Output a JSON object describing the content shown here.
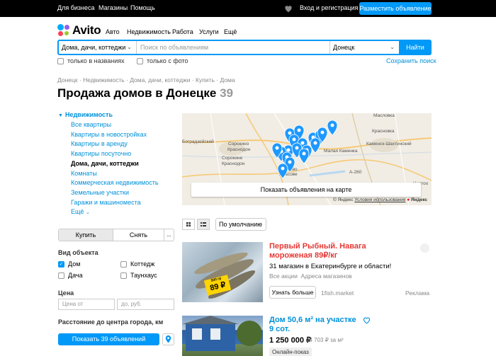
{
  "topbar": {
    "links": [
      "Для бизнеса",
      "Магазины",
      "Помощь"
    ],
    "login": "Вход и регистрация",
    "post_ad": "Разместить объявление"
  },
  "logo": "Avito",
  "nav": [
    "Авто",
    "Недвижимость",
    "Работа",
    "Услуги",
    "Ещё"
  ],
  "search": {
    "category": "Дома, дачи, коттеджи",
    "placeholder": "Поиск по объявлениям",
    "city": "Донецк",
    "find": "Найти",
    "titles_only": "только в названиях",
    "with_photo": "только с фото",
    "save": "Сохранить поиск"
  },
  "breadcrumb": [
    "Донецк",
    "Недвижимость",
    "Дома, дачи, коттеджи",
    "Купить",
    "Дома"
  ],
  "title": "Продажа домов в Донецке",
  "title_count": "39",
  "sidebar": {
    "category": "Недвижимость",
    "items": [
      "Все квартиры",
      "Квартиры в новостройках",
      "Квартиры в аренду",
      "Квартиры посуточно",
      "Дома, дачи, коттеджи",
      "Комнаты",
      "Коммерческая недвижимость",
      "Земельные участки",
      "Гаражи и машиноместа",
      "Ещё"
    ],
    "deal": {
      "buy": "Купить",
      "rent": "Снять",
      "more": "..."
    },
    "object_type_heading": "Вид объекта",
    "object_types": [
      {
        "label": "Дом",
        "checked": true
      },
      {
        "label": "Коттедж",
        "checked": false
      },
      {
        "label": "Дача",
        "checked": false
      },
      {
        "label": "Таунхаус",
        "checked": false
      }
    ],
    "price_heading": "Цена",
    "price_from": "Цена от",
    "price_to": "до, руб.",
    "distance_heading": "Расстояние до центра города, км",
    "show_btn": "Показать 39 объявлений"
  },
  "map": {
    "show_on_map": "Показать объявления на карте",
    "copyright": "© Яндекс",
    "terms": "Условия использования",
    "brand": "Яндекс",
    "labels": [
      "Масловка",
      "Красновка",
      "Каменск-Шахтинский",
      "Малая Каменка",
      "Сорокино",
      "Краснодон",
      "Сорокине",
      "Краснодон",
      "Власово",
      "Власове",
      "Боградзейский",
      "Чистоо",
      "А-260"
    ]
  },
  "toolbar": {
    "sort": "По умолчанию"
  },
  "listings": [
    {
      "title": "Первый Рыбный. Навага мороженая 89₽/кг",
      "text": "31 магазин в Екатеринбурге и области!",
      "sub1": "Все акции",
      "sub2": "Адреса магазинов",
      "btn": "Узнать больше",
      "source": "1fish.market",
      "ad_label": "Реклама",
      "sticker_weight": "500 гр",
      "sticker_price": "89 ₽",
      "title_color": "#e53935"
    },
    {
      "title": "Дом 50,6 м² на участке 9 сот.",
      "price": "1 250 000 ₽",
      "price_per_m": "24 703 ₽ за м²",
      "badge": "Онлайн-показ"
    }
  ],
  "colors": {
    "accent": "#0099f7",
    "link": "#0091d9",
    "promo_title": "#e53935",
    "pin": "#1e98ff"
  }
}
